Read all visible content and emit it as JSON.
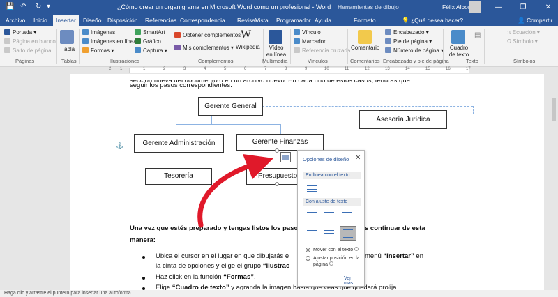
{
  "title_bar": {
    "title": "¿Cómo crear un organigrama en Microsoft Word como un profesional  -  Word",
    "context_tools": "Herramientas de dibujo",
    "user_name": "Félix Albornoz",
    "qa_save": "💾",
    "qa_undo": "↶",
    "qa_redo": "↻",
    "qa_more": "▾",
    "min_symbol": "—",
    "max_symbol": "❐",
    "close_symbol": "✕"
  },
  "tabs": [
    "Archivo",
    "Inicio",
    "Insertar",
    "Diseño",
    "Disposición",
    "Referencias",
    "Correspondencia",
    "Revisar",
    "Vista",
    "Programador",
    "Ayuda",
    "Formato"
  ],
  "tell_me": "¿Qué desea hacer?",
  "share": "Compartir",
  "ribbon": {
    "paginas": {
      "label": "Páginas",
      "portada": "Portada",
      "pagina_blanco": "Página en blanco",
      "salto": "Salto de página"
    },
    "tablas": {
      "label": "Tablas",
      "tabla": "Tabla"
    },
    "ilustraciones": {
      "label": "Ilustraciones",
      "imagenes": "Imágenes",
      "imagenes_linea": "Imágenes en línea",
      "formas": "Formas",
      "smartart": "SmartArt",
      "grafico": "Gráfico",
      "captura": "Captura"
    },
    "complementos": {
      "label": "Complementos",
      "obtener": "Obtener complementos",
      "mis": "Mis complementos",
      "wikipedia": "Wikipedia"
    },
    "multimedia": {
      "label": "Multimedia",
      "video": "Vídeo en línea"
    },
    "vinculos": {
      "label": "Vínculos",
      "vinculo": "Vínculo",
      "marcador": "Marcador",
      "referencia": "Referencia cruzada"
    },
    "comentarios": {
      "label": "Comentarios",
      "comentario": "Comentario"
    },
    "encabezado": {
      "label": "Encabezado y pie de página",
      "encabezado": "Encabezado",
      "pie": "Pie de página",
      "numero": "Número de página"
    },
    "texto": {
      "label": "Texto",
      "cuadro": "Cuadro de texto"
    },
    "simbolos": {
      "label": "Símbolos",
      "ecuacion": "Ecuación",
      "simbolo": "Símbolo"
    }
  },
  "ruler": [
    "2",
    "1",
    "1",
    "2",
    "3",
    "4",
    "5",
    "6",
    "7",
    "8",
    "9",
    "10",
    "11",
    "12",
    "13",
    "14",
    "15",
    "16",
    "17"
  ],
  "document": {
    "line1": "sección nueva del documento o en un archivo nuevo. En cada uno de estos casos, tendrás que",
    "line2": "seguir los pasos correspondientes.",
    "para_a": "Una vez que estés preparado y tengas listos los paso",
    "para_b": "s continuar de esta",
    "para_c": "manera:",
    "b1a": "Ubica el cursor en el lugar en que dibujarás e",
    "b1b": "menú ",
    "b1c": "“Insertar”",
    "b1d": " en",
    "b1e": "la cinta de opciones y elige el grupo ",
    "b1f": "“Ilustrac",
    "b2a": "Haz click en la función ",
    "b2b": "“Formas”",
    "b2c": ".",
    "b3a": "Elige ",
    "b3b": "“Cuadro de texto”",
    "b3c": " y agranda la imagen hasta que veas que quedará prolija."
  },
  "org_chart": {
    "gerente_general": "Gerente General",
    "asesoria": "Asesoría Jurídica",
    "gerente_admin": "Gerente Administración",
    "gerente_finanzas": "Gerente Finanzas",
    "tesoreria": "Tesorería",
    "presupuesto": "Presupuesto"
  },
  "layout_popup": {
    "title": "Opciones de diseño",
    "close": "✕",
    "section_inline": "En línea con el texto",
    "section_wrap": "Con ajuste de texto",
    "radio_move": "Mover con el texto",
    "radio_fix": "Ajustar posición en la página",
    "see_more": "Ver más..."
  },
  "status": "Haga clic y arrastre el puntero para insertar una autoforma.",
  "colors": {
    "accent": "#2b579a",
    "arrow": "#e0192a",
    "connector": "#8db3e2"
  }
}
